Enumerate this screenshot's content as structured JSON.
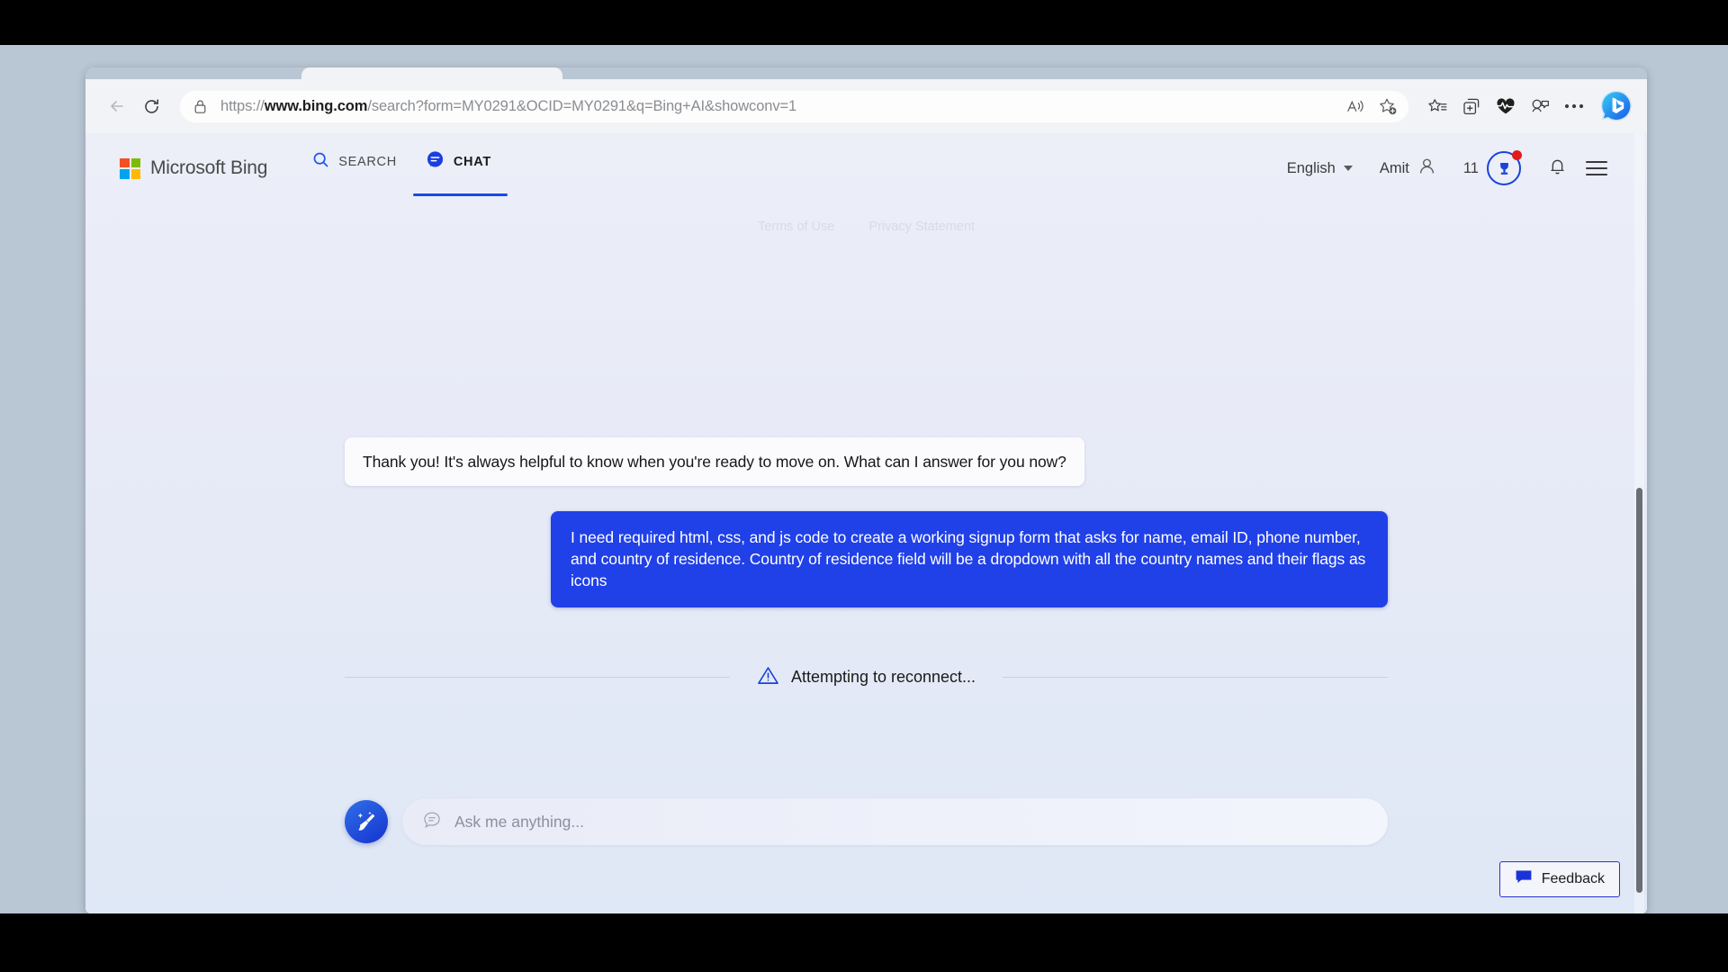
{
  "browser": {
    "url_prefix": "https://",
    "url_domain": "www.bing.com",
    "url_path": "/search?form=MY0291&OCID=MY0291&q=Bing+AI&showconv=1",
    "url_full": "https://www.bing.com/search?form=MY0291&OCID=MY0291&q=Bing+AI&showconv=1",
    "icons": {
      "back": "back-arrow-icon",
      "reload": "reload-icon",
      "site_info": "lock-icon",
      "read_aloud": "read-aloud-icon",
      "add_favorite": "add-favorite-star-icon",
      "favorites": "favorites-list-icon",
      "collections": "collections-icon",
      "browser_essentials": "browser-essentials-heart-icon",
      "copilot_chat": "copilot-bubbles-icon",
      "settings_more": "more-options-icon",
      "bing_chat": "bing-chat-logo-icon"
    }
  },
  "bing": {
    "logo_text": "Microsoft Bing",
    "logo_colors": [
      "#f25022",
      "#7fba00",
      "#00a4ef",
      "#ffb900"
    ],
    "tabs": [
      {
        "label": "SEARCH",
        "icon": "search-icon",
        "active": false
      },
      {
        "label": "CHAT",
        "icon": "chat-bubble-icon",
        "active": true
      }
    ],
    "language": "English",
    "user_name": "Amit",
    "rewards_points": "11",
    "rewards_icon": "rewards-trophy-icon",
    "notifications_icon": "bell-icon",
    "menu_icon": "hamburger-menu-icon",
    "accent_color": "#174ae6"
  },
  "legal": {
    "terms": "Terms of Use",
    "privacy": "Privacy Statement"
  },
  "conversation": {
    "messages": [
      {
        "role": "bot",
        "text": "Thank you! It's always helpful to know when you're ready to move on. What can I answer for you now?"
      },
      {
        "role": "user",
        "text": "I need required html, css, and js code to create a working signup form that asks for name, email ID, phone number, and country of residence. Country of residence field will be a dropdown with all the country names and their flags as icons"
      }
    ],
    "status": {
      "text": "Attempting to reconnect...",
      "icon": "warning-triangle-icon",
      "color": "#1a43d8"
    }
  },
  "composer": {
    "new_topic_icon": "broom-new-topic-icon",
    "input_icon": "chat-bubble-icon",
    "placeholder": "Ask me anything...",
    "value": ""
  },
  "feedback": {
    "label": "Feedback",
    "icon": "feedback-bubble-icon",
    "border_color": "#2633cf"
  }
}
